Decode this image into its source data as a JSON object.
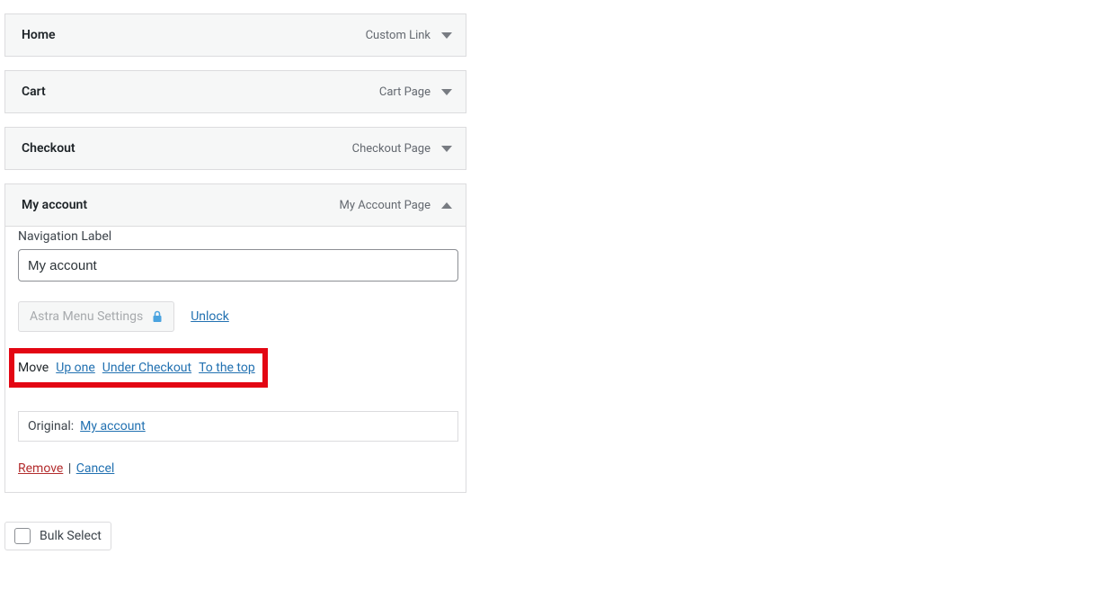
{
  "menuItems": [
    {
      "title": "Home",
      "type": "Custom Link",
      "expanded": false
    },
    {
      "title": "Cart",
      "type": "Cart Page",
      "expanded": false
    },
    {
      "title": "Checkout",
      "type": "Checkout Page",
      "expanded": false
    },
    {
      "title": "My account",
      "type": "My Account Page",
      "expanded": true
    }
  ],
  "settings": {
    "navigationLabel": "Navigation Label",
    "navigationValue": "My account",
    "astraButton": "Astra Menu Settings",
    "unlock": "Unlock",
    "moveLabel": "Move",
    "moveUpOne": "Up one",
    "moveUnder": "Under Checkout",
    "moveToTop": "To the top",
    "originalLabel": "Original:",
    "originalLink": "My account",
    "remove": "Remove",
    "cancel": "Cancel"
  },
  "bulkSelect": "Bulk Select"
}
